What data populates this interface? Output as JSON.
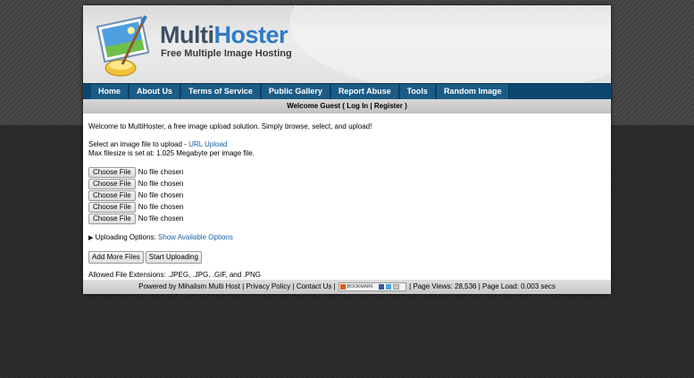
{
  "header": {
    "logo_text_a": "Multi",
    "logo_text_b": "Hoster",
    "tagline": "Free Multiple Image Hosting"
  },
  "nav": {
    "items": [
      "Home",
      "About Us",
      "Terms of Service",
      "Public Gallery",
      "Report Abuse",
      "Tools",
      "Random Image"
    ]
  },
  "welcome": {
    "prefix": "Welcome Guest ( ",
    "login": "Log In",
    "sep": " | ",
    "register": "Register",
    "suffix": " )"
  },
  "content": {
    "intro": "Welcome to MultiHoster, a free image upload solution. Simply browse, select, and upload!",
    "select_prefix": "Select an image file to upload - ",
    "url_upload": "URL Upload",
    "max_filesize": "Max filesize is set at: 1.025 Megabyte per image file.",
    "choose_label": "Choose File",
    "no_file": "No file chosen",
    "uploading_options_label": "Uploading Options:",
    "show_options": "Show Available Options",
    "add_more": "Add More Files",
    "start_upload": "Start Uploading",
    "allowed": "Allowed File Extensions: .JPEG, .JPG, .GIF, and .PNG"
  },
  "footer": {
    "powered": "Powered by Mihalism Multi Host",
    "privacy": "Privacy Policy",
    "contact": "Contact Us",
    "bookmark": "BOOKMARK",
    "page_views": "Page Views: 28,536",
    "page_load": "Page Load: 0.003 secs"
  },
  "colors": {
    "nav_bg": "#0d4770",
    "logo_blue": "#2f7cc4",
    "link": "#1a5fa8"
  },
  "icons": [
    "paint-palette-logo-icon",
    "bookmark-plus-icon",
    "facebook-icon",
    "twitter-icon",
    "email-icon"
  ]
}
